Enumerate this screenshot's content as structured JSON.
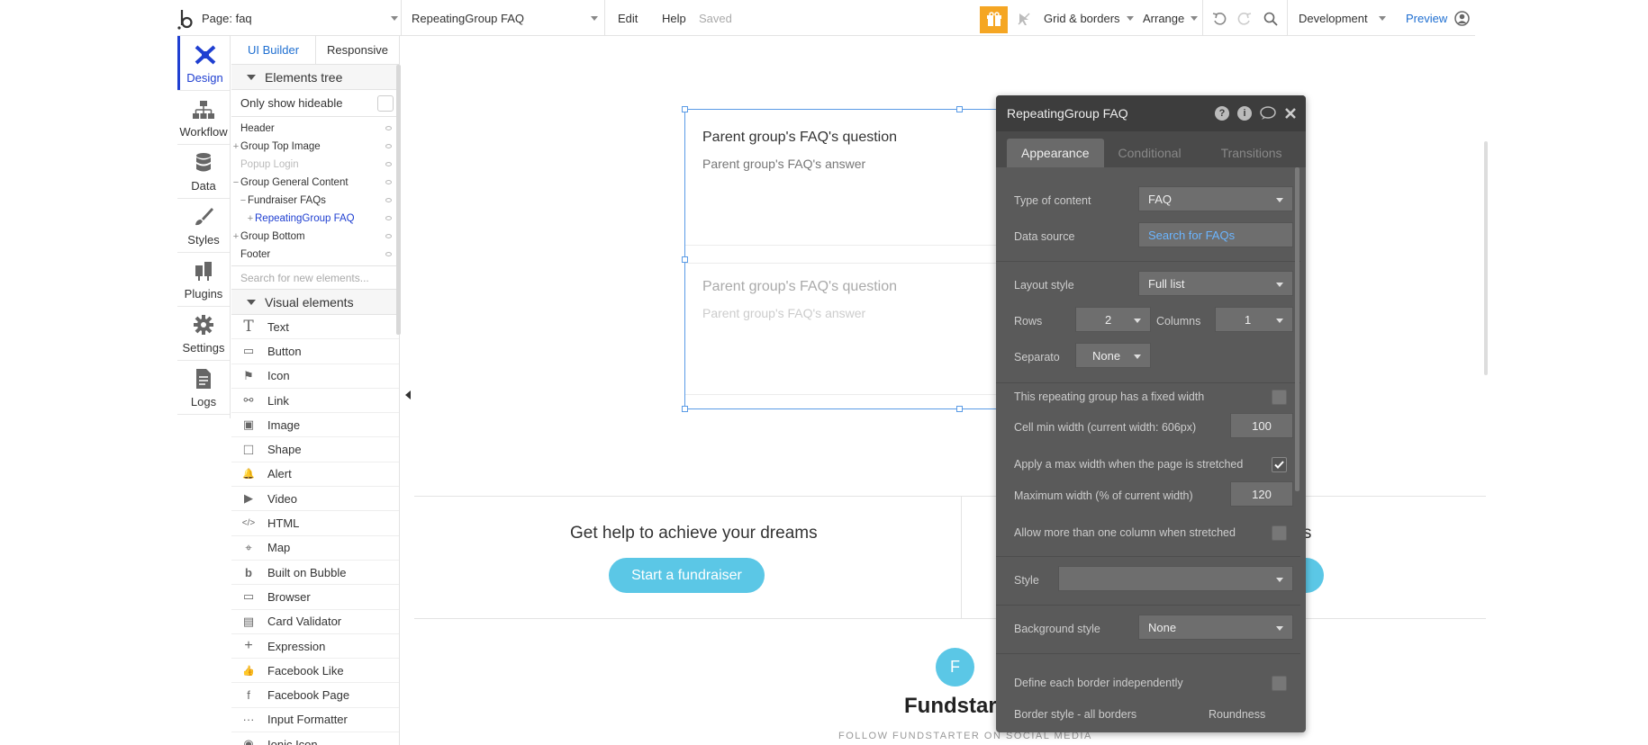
{
  "topbar": {
    "page_label": "Page: faq",
    "element_select": "RepeatingGroup FAQ",
    "menu_edit": "Edit",
    "menu_help": "Help",
    "status_saved": "Saved",
    "grid_borders": "Grid & borders",
    "arrange": "Arrange",
    "environment": "Development",
    "preview": "Preview"
  },
  "rail": {
    "items": [
      {
        "label": "Design",
        "icon": "design-icon"
      },
      {
        "label": "Workflow",
        "icon": "workflow-icon"
      },
      {
        "label": "Data",
        "icon": "database-icon"
      },
      {
        "label": "Styles",
        "icon": "brush-icon"
      },
      {
        "label": "Plugins",
        "icon": "plug-icon"
      },
      {
        "label": "Settings",
        "icon": "gear-icon"
      },
      {
        "label": "Logs",
        "icon": "document-icon"
      }
    ]
  },
  "panel": {
    "tab_ui_builder": "UI Builder",
    "tab_responsive": "Responsive",
    "elements_tree_title": "Elements tree",
    "only_show_hideable": "Only show hideable",
    "tree": [
      {
        "label": "Header",
        "prefix": ""
      },
      {
        "label": "Group Top Image",
        "prefix": "+"
      },
      {
        "label": "Popup Login",
        "prefix": ""
      },
      {
        "label": "Group General Content",
        "prefix": "−"
      },
      {
        "label": "Fundraiser FAQs",
        "prefix": "−"
      },
      {
        "label": "RepeatingGroup FAQ",
        "prefix": "+"
      },
      {
        "label": "Group Bottom",
        "prefix": "+"
      },
      {
        "label": "Footer",
        "prefix": ""
      }
    ],
    "search_placeholder": "Search for new elements...",
    "visual_elements_title": "Visual elements",
    "visual_elements": [
      {
        "label": "Text",
        "icon": "T"
      },
      {
        "label": "Button",
        "icon": "▭"
      },
      {
        "label": "Icon",
        "icon": "⚑"
      },
      {
        "label": "Link",
        "icon": "⚯"
      },
      {
        "label": "Image",
        "icon": "▣"
      },
      {
        "label": "Shape",
        "icon": "□"
      },
      {
        "label": "Alert",
        "icon": "🔔"
      },
      {
        "label": "Video",
        "icon": "▶"
      },
      {
        "label": "HTML",
        "icon": "</>"
      },
      {
        "label": "Map",
        "icon": "⌖"
      },
      {
        "label": "Built on Bubble",
        "icon": "b"
      },
      {
        "label": "Browser",
        "icon": "▭"
      },
      {
        "label": "Card Validator",
        "icon": "▤"
      },
      {
        "label": "Expression",
        "icon": "+"
      },
      {
        "label": "Facebook Like",
        "icon": "👍"
      },
      {
        "label": "Facebook Page",
        "icon": "f"
      },
      {
        "label": "Input Formatter",
        "icon": "···"
      },
      {
        "label": "Ionic Icon",
        "icon": "◉"
      }
    ]
  },
  "canvas": {
    "cell1_question": "Parent group's FAQ's question",
    "cell1_answer": "Parent group's FAQ's answer",
    "cell2_question": "Parent group's FAQ's question",
    "cell2_answer": "Parent group's FAQ's answer",
    "help_title": "Get help to achieve your dreams",
    "help_right_fragment": "ers",
    "start_button": "Start a fundraiser",
    "logo_letter": "F",
    "brand": "Fundstart",
    "follow": "FOLLOW FUNDSTARTER ON SOCIAL MEDIA"
  },
  "property_editor": {
    "title": "RepeatingGroup FAQ",
    "tabs": [
      "Appearance",
      "Conditional",
      "Transitions"
    ],
    "type_of_content_label": "Type of content",
    "type_of_content_value": "FAQ",
    "data_source_label": "Data source",
    "data_source_value": "Search for FAQs",
    "layout_style_label": "Layout style",
    "layout_style_value": "Full list",
    "rows_label": "Rows",
    "rows_value": "2",
    "columns_label": "Columns",
    "columns_value": "1",
    "separator_label": "Separato",
    "separator_value": "None",
    "fixed_width_label": "This repeating group has a fixed width",
    "cell_min_width_label": "Cell min width (current width: 606px)",
    "cell_min_width_value": "100",
    "max_width_label": "Apply a max width when the page is stretched",
    "max_width_pct_label": "Maximum width (% of current width)",
    "max_width_pct_value": "120",
    "multi_column_label": "Allow more than one column when stretched",
    "style_label": "Style",
    "style_value": "",
    "background_style_label": "Background style",
    "background_style_value": "None",
    "border_independent_label": "Define each border independently",
    "border_style_label": "Border style - all borders",
    "roundness_label": "Roundness"
  },
  "colors": {
    "accent_blue": "#1f6fd1",
    "gift_orange": "#f5a623",
    "button_cyan": "#5bc7e6",
    "editor_bg": "#5a5a5a",
    "editor_header": "#3d3d3d"
  }
}
